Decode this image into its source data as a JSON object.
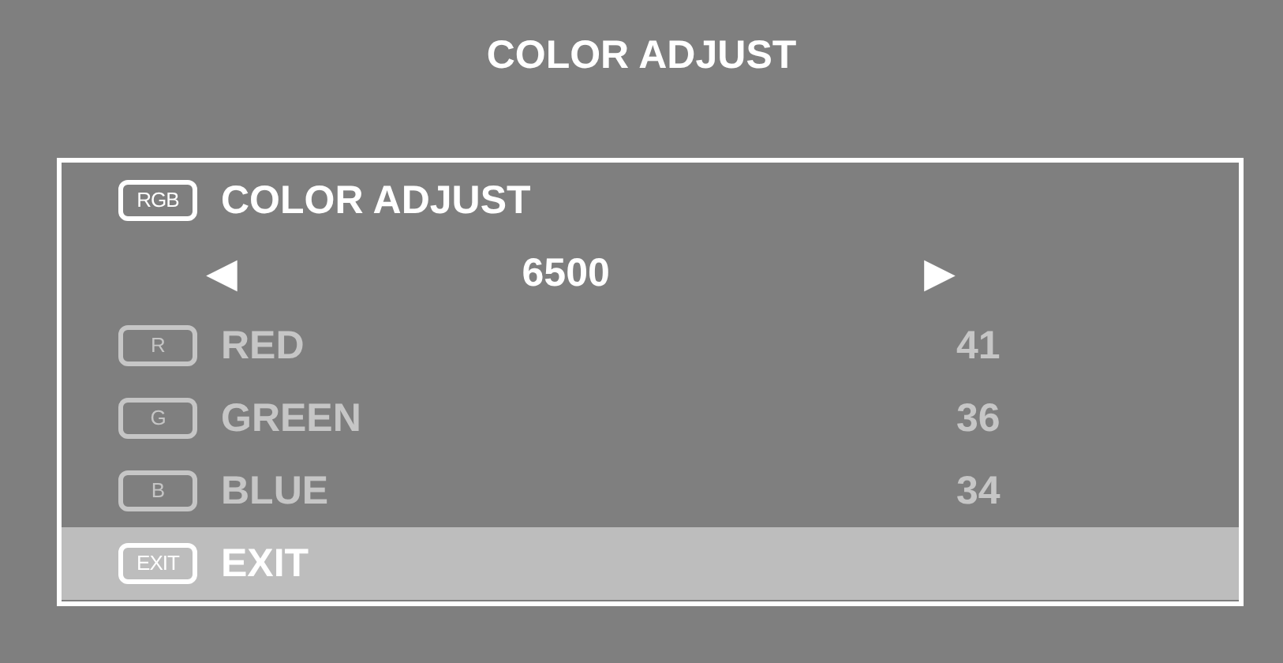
{
  "title": "COLOR ADJUST",
  "rows": [
    {
      "kind": "item",
      "icon_text": "RGB",
      "label": "COLOR ADJUST",
      "disabled": false,
      "selected": false
    },
    {
      "kind": "selector",
      "left": "◀",
      "value": "6500",
      "right": "▶",
      "disabled": false,
      "selected": false
    },
    {
      "kind": "item",
      "icon_text": "R",
      "label": "RED",
      "value": "41",
      "disabled": true,
      "selected": false
    },
    {
      "kind": "item",
      "icon_text": "G",
      "label": "GREEN",
      "value": "36",
      "disabled": true,
      "selected": false
    },
    {
      "kind": "item",
      "icon_text": "B",
      "label": "BLUE",
      "value": "34",
      "disabled": true,
      "selected": false
    },
    {
      "kind": "item",
      "icon_text": "EXIT",
      "label": "EXIT",
      "disabled": false,
      "selected": true
    }
  ]
}
